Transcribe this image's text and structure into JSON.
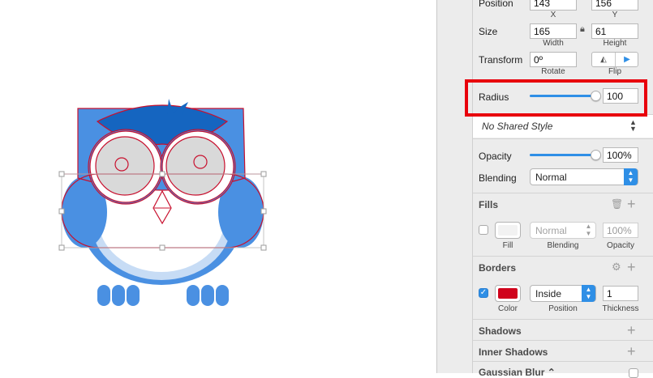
{
  "inspector": {
    "position": {
      "label": "Position",
      "x": "143",
      "y": "156",
      "x_label": "X",
      "y_label": "Y"
    },
    "size": {
      "label": "Size",
      "width": "165",
      "height": "61",
      "width_label": "Width",
      "height_label": "Height",
      "lock_icon": "lock-icon"
    },
    "transform": {
      "label": "Transform",
      "rotate": "0º",
      "rotate_label": "Rotate",
      "flip_label": "Flip"
    },
    "radius": {
      "label": "Radius",
      "value": "100",
      "slider_level": 1.0
    },
    "shared_style": {
      "value": "No Shared Style"
    },
    "opacity": {
      "label": "Opacity",
      "value": "100%",
      "slider_level": 1.0
    },
    "blending": {
      "label": "Blending",
      "value": "Normal"
    },
    "fills": {
      "title": "Fills",
      "blend": "Normal",
      "opacity": "100%",
      "fill_label": "Fill",
      "blending_label": "Blending",
      "opacity_label": "Opacity",
      "enabled": false,
      "color": "#f2f2f2"
    },
    "borders": {
      "title": "Borders",
      "position": "Inside",
      "thickness": "1",
      "color_label": "Color",
      "position_label": "Position",
      "thickness_label": "Thickness",
      "enabled": true,
      "color": "#d0021b"
    },
    "shadows": {
      "title": "Shadows"
    },
    "inner_shadows": {
      "title": "Inner Shadows"
    },
    "gaussian_blur": {
      "title": "Gaussian Blur ⌃"
    }
  },
  "colors": {
    "owl_blue": "#4a90e2",
    "owl_dark_blue": "#1565c0",
    "owl_light_blue": "#c7dcf5",
    "selection_red": "#c8102e",
    "highlight_red": "#e8000c",
    "accent_blue": "#2f8fe6"
  }
}
